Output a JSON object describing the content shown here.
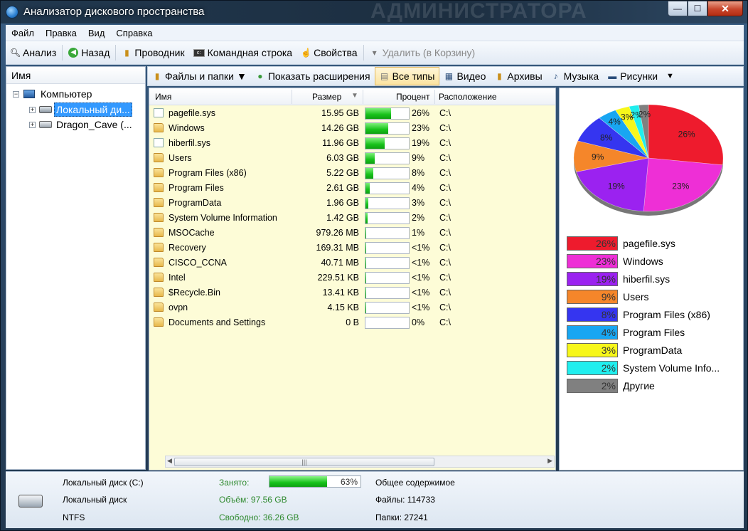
{
  "window": {
    "title": "Анализатор дискового пространства",
    "watermark": "АДМИНИСТРАТОРА",
    "btn_min": "—",
    "btn_max": "☐",
    "btn_close": "✕"
  },
  "menu": [
    "Файл",
    "Правка",
    "Вид",
    "Справка"
  ],
  "toolbar": {
    "analyze": "Анализ",
    "back": "Назад",
    "explorer": "Проводник",
    "cmd": "Командная строка",
    "properties": "Свойства",
    "delete": "Удалить (в Корзину)"
  },
  "tree": {
    "header": "Имя",
    "root": "Компьютер",
    "items": [
      "Локальный ди...",
      "Dragon_Cave (..."
    ]
  },
  "filters": {
    "files_folders": "Файлы и папки",
    "show_ext": "Показать расширения",
    "all_types": "Все типы",
    "video": "Видео",
    "archives": "Архивы",
    "music": "Музыка",
    "pictures": "Рисунки"
  },
  "list": {
    "columns": {
      "name": "Имя",
      "size": "Размер",
      "percent": "Процент",
      "location": "Расположение"
    },
    "rows": [
      {
        "name": "pagefile.sys",
        "type": "file",
        "size": "15.95 GB",
        "fill": 26,
        "percent": "26%",
        "loc": "C:\\"
      },
      {
        "name": "Windows",
        "type": "folder",
        "size": "14.26 GB",
        "fill": 23,
        "percent": "23%",
        "loc": "C:\\"
      },
      {
        "name": "hiberfil.sys",
        "type": "file",
        "size": "11.96 GB",
        "fill": 19,
        "percent": "19%",
        "loc": "C:\\"
      },
      {
        "name": "Users",
        "type": "folder",
        "size": "6.03 GB",
        "fill": 9,
        "percent": "9%",
        "loc": "C:\\"
      },
      {
        "name": "Program Files (x86)",
        "type": "folder",
        "size": "5.22 GB",
        "fill": 8,
        "percent": "8%",
        "loc": "C:\\"
      },
      {
        "name": "Program Files",
        "type": "folder",
        "size": "2.61 GB",
        "fill": 4,
        "percent": "4%",
        "loc": "C:\\"
      },
      {
        "name": "ProgramData",
        "type": "folder",
        "size": "1.96 GB",
        "fill": 3,
        "percent": "3%",
        "loc": "C:\\"
      },
      {
        "name": "System Volume Information",
        "type": "folder",
        "size": "1.42 GB",
        "fill": 2,
        "percent": "2%",
        "loc": "C:\\"
      },
      {
        "name": "MSOCache",
        "type": "folder",
        "size": "979.26 MB",
        "fill": 1,
        "percent": "1%",
        "loc": "C:\\"
      },
      {
        "name": "Recovery",
        "type": "folder",
        "size": "169.31 MB",
        "fill": 0.3,
        "percent": "<1%",
        "loc": "C:\\"
      },
      {
        "name": "CISCO_CCNA",
        "type": "folder",
        "size": "40.71 MB",
        "fill": 0.1,
        "percent": "<1%",
        "loc": "C:\\"
      },
      {
        "name": "Intel",
        "type": "folder",
        "size": "229.51 KB",
        "fill": 0.05,
        "percent": "<1%",
        "loc": "C:\\"
      },
      {
        "name": "$Recycle.Bin",
        "type": "folder",
        "size": "13.41 KB",
        "fill": 0.05,
        "percent": "<1%",
        "loc": "C:\\"
      },
      {
        "name": "ovpn",
        "type": "folder",
        "size": "4.15 KB",
        "fill": 0.05,
        "percent": "<1%",
        "loc": "C:\\"
      },
      {
        "name": "Documents and Settings",
        "type": "folder",
        "size": "0 B",
        "fill": 0,
        "percent": "0%",
        "loc": "C:\\"
      }
    ]
  },
  "chart_data": {
    "type": "pie",
    "labels": [
      "pagefile.sys",
      "Windows",
      "hiberfil.sys",
      "Users",
      "Program Files (x86)",
      "Program Files",
      "ProgramData",
      "System Volume Info...",
      "Другие"
    ],
    "values": [
      26,
      23,
      19,
      9,
      8,
      4,
      3,
      2,
      2
    ],
    "value_labels": [
      "26%",
      "23%",
      "19%",
      "9%",
      "8%",
      "4%",
      "3%",
      "2%",
      "2%"
    ],
    "colors": [
      "#ee1b2d",
      "#ee2fd6",
      "#9b22f0",
      "#f5862a",
      "#3535f0",
      "#18a6f2",
      "#f7f71a",
      "#20eeee",
      "#808080"
    ],
    "legend_placement": "bottom"
  },
  "status": {
    "disk_name": "Локальный диск (C:)",
    "disk_type": "Локальный диск",
    "fs": "NTFS",
    "used_label": "Занято:",
    "used_fill": 63,
    "used_pct": "63%",
    "volume": "Объём: 97.56 GB",
    "free": "Свободно: 36.26 GB",
    "total_content": "Общее содержимое",
    "files": "Файлы: 114733",
    "folders": "Папки: 27241"
  }
}
